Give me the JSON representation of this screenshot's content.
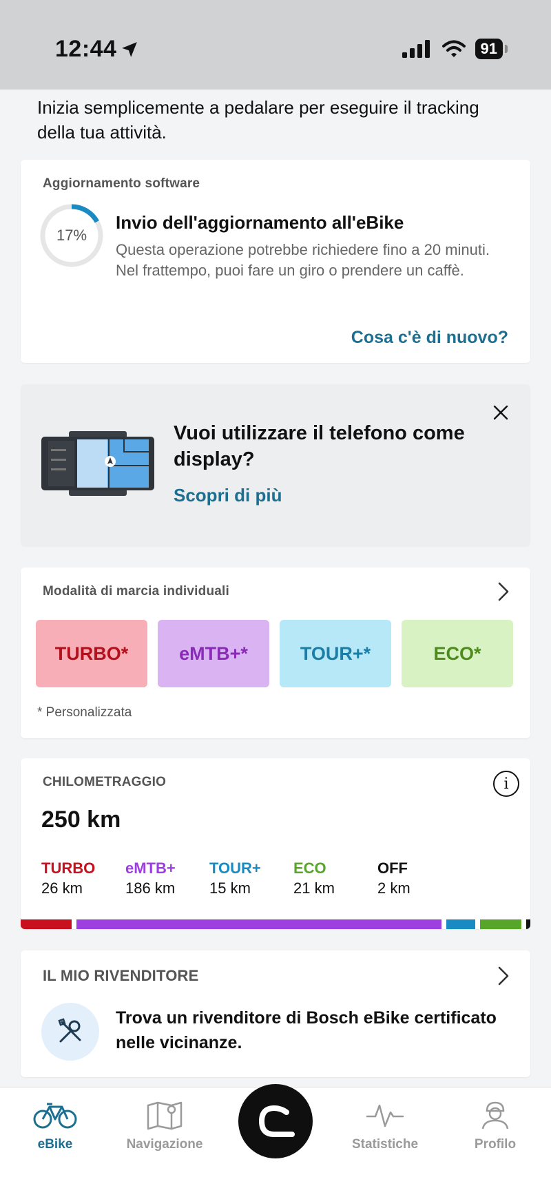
{
  "status_bar": {
    "time": "12:44",
    "battery": "91"
  },
  "intro": "Inizia semplicemente a pedalare per eseguire il tracking della tua attività.",
  "software_update": {
    "title": "Aggiornamento software",
    "progress_label": "17%",
    "progress": 0.17,
    "heading": "Invio dell'aggiornamento all'eBike",
    "body": "Questa operazione potrebbe richiedere fino a 20 minuti. Nel frattempo, puoi fare un giro o prendere un caffè.",
    "link": "Cosa c'è di nuovo?"
  },
  "promo": {
    "heading": "Vuoi utilizzare il telefono come display?",
    "link": "Scopri di più"
  },
  "riding_modes": {
    "title": "Modalità di marcia individuali",
    "modes": [
      {
        "label": "TURBO*",
        "bg": "#f8aeb6",
        "fg": "#b3101d"
      },
      {
        "label": "eMTB+*",
        "bg": "#d9b3f2",
        "fg": "#8a2bb8"
      },
      {
        "label": "TOUR+*",
        "bg": "#b6e8f7",
        "fg": "#1b7ea7"
      },
      {
        "label": "ECO*",
        "bg": "#d9f2c4",
        "fg": "#4e8a1d"
      }
    ],
    "footnote": "* Personalizzata"
  },
  "mileage": {
    "title": "CHILOMETRAGGIO",
    "total": "250 km",
    "items": [
      {
        "name": "TURBO",
        "value": "26 km",
        "km": 26,
        "color": "#c8101e"
      },
      {
        "name": "eMTB+",
        "value": "186 km",
        "km": 186,
        "color": "#9d3fe0"
      },
      {
        "name": "TOUR+",
        "value": "15 km",
        "km": 15,
        "color": "#1a8bc2"
      },
      {
        "name": "ECO",
        "value": "21 km",
        "km": 21,
        "color": "#58a629"
      },
      {
        "name": "OFF",
        "value": "2 km",
        "km": 2,
        "color": "#111111"
      }
    ]
  },
  "dealer": {
    "title": "IL MIO RIVENDITORE",
    "text": "Trova un rivenditore di Bosch eBike certificato nelle vicinanze."
  },
  "tabs": [
    {
      "label": "eBike",
      "active": true
    },
    {
      "label": "Navigazione",
      "active": false
    },
    {
      "label": "Statistiche",
      "active": false
    },
    {
      "label": "Profilo",
      "active": false
    }
  ],
  "colors": {
    "accent": "#1d6f92"
  }
}
